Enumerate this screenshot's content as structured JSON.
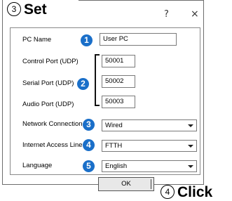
{
  "callouts": {
    "step3_number": "3",
    "step3_label": "Set",
    "step4_number": "4",
    "step4_label": "Click"
  },
  "window_buttons": {
    "help": "?",
    "close": "×"
  },
  "fields": {
    "pc_name": {
      "label": "PC Name",
      "badge": "1",
      "value": "User PC"
    },
    "control_port": {
      "label": "Control Port (UDP)",
      "value": "50001"
    },
    "serial_port": {
      "label": "Serial Port (UDP)",
      "value": "50002"
    },
    "audio_port": {
      "label": "Audio Port (UDP)",
      "value": "50003"
    },
    "ports_badge": "2",
    "network_connection": {
      "label": "Network Connection",
      "badge": "3",
      "value": "Wired"
    },
    "internet_access": {
      "label": "Internet Access Line",
      "badge": "4",
      "value": "FTTH"
    },
    "language": {
      "label": "Language",
      "badge": "5",
      "value": "English"
    }
  },
  "buttons": {
    "ok": "OK"
  },
  "colors": {
    "badge": "#1a6fc9"
  }
}
